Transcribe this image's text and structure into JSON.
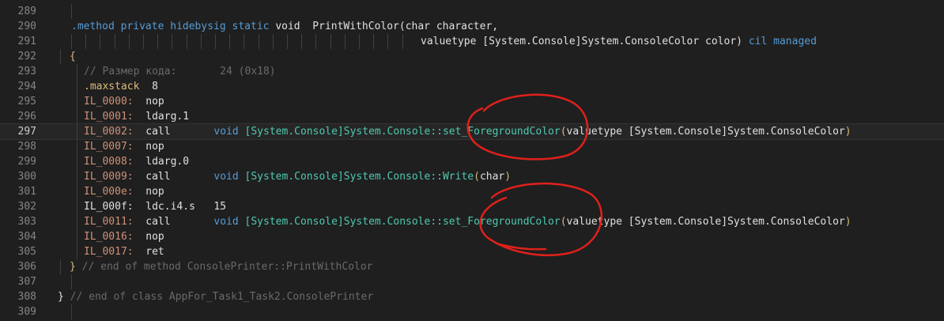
{
  "editor": {
    "lines": [
      {
        "n": "289",
        "segs": []
      },
      {
        "n": "290",
        "segs": [
          {
            "t": ".method",
            "c": "t-kw"
          },
          {
            "t": " "
          },
          {
            "t": "private",
            "c": "t-kw"
          },
          {
            "t": " "
          },
          {
            "t": "hidebysig",
            "c": "t-kw"
          },
          {
            "t": " "
          },
          {
            "t": "static",
            "c": "t-kw"
          },
          {
            "t": " "
          },
          {
            "t": "void",
            "c": "t-white"
          },
          {
            "t": "  "
          },
          {
            "t": "PrintWithColor(char character,",
            "c": "t-white"
          }
        ]
      },
      {
        "n": "291",
        "segs": [
          {
            "t": "valuetype [System.Console]System.ConsoleColor color)",
            "c": "t-white"
          },
          {
            "t": " "
          },
          {
            "t": "cil",
            "c": "t-kw"
          },
          {
            "t": " "
          },
          {
            "t": "managed",
            "c": "t-kw"
          }
        ]
      },
      {
        "n": "292",
        "segs": [
          {
            "t": "{",
            "c": "t-brace"
          }
        ]
      },
      {
        "n": "293",
        "segs": [
          {
            "t": "// Размер кода:       24 (0x18)",
            "c": "t-comment"
          }
        ]
      },
      {
        "n": "294",
        "segs": [
          {
            "t": ".maxstack",
            "c": "t-dir"
          },
          {
            "t": "  "
          },
          {
            "t": "8",
            "c": "t-white"
          }
        ]
      },
      {
        "n": "295",
        "segs": [
          {
            "t": "IL_0000:",
            "c": "t-label"
          },
          {
            "t": "  "
          },
          {
            "t": "nop",
            "c": "t-white"
          }
        ]
      },
      {
        "n": "296",
        "segs": [
          {
            "t": "IL_0001:",
            "c": "t-label"
          },
          {
            "t": "  "
          },
          {
            "t": "ldarg.1",
            "c": "t-white"
          }
        ]
      },
      {
        "n": "297",
        "current": true,
        "segs": [
          {
            "t": "IL_0002:",
            "c": "t-label"
          },
          {
            "t": "  "
          },
          {
            "t": "call",
            "c": "t-white"
          },
          {
            "t": "       "
          },
          {
            "t": "void",
            "c": "t-kw"
          },
          {
            "t": " "
          },
          {
            "t": "[System.Console]System.Console::set_ForegroundColor",
            "c": "t-type"
          },
          {
            "t": "(",
            "c": "t-brace"
          },
          {
            "t": "valuetype [System.Console]System.ConsoleColor",
            "c": "t-white"
          },
          {
            "t": ")",
            "c": "t-brace"
          }
        ]
      },
      {
        "n": "298",
        "segs": [
          {
            "t": "IL_0007:",
            "c": "t-label"
          },
          {
            "t": "  "
          },
          {
            "t": "nop",
            "c": "t-white"
          }
        ]
      },
      {
        "n": "299",
        "segs": [
          {
            "t": "IL_0008:",
            "c": "t-label"
          },
          {
            "t": "  "
          },
          {
            "t": "ldarg.0",
            "c": "t-white"
          }
        ]
      },
      {
        "n": "300",
        "segs": [
          {
            "t": "IL_0009:",
            "c": "t-label"
          },
          {
            "t": "  "
          },
          {
            "t": "call",
            "c": "t-white"
          },
          {
            "t": "       "
          },
          {
            "t": "void",
            "c": "t-kw"
          },
          {
            "t": " "
          },
          {
            "t": "[System.Console]System.Console::Write",
            "c": "t-type"
          },
          {
            "t": "(",
            "c": "t-brace"
          },
          {
            "t": "char",
            "c": "t-white"
          },
          {
            "t": ")",
            "c": "t-brace"
          }
        ]
      },
      {
        "n": "301",
        "segs": [
          {
            "t": "IL_000e:",
            "c": "t-label"
          },
          {
            "t": "  "
          },
          {
            "t": "nop",
            "c": "t-white"
          }
        ]
      },
      {
        "n": "302",
        "segs": [
          {
            "t": "IL_000f:",
            "c": "t-white"
          },
          {
            "t": "  "
          },
          {
            "t": "ldc.i4.s",
            "c": "t-white"
          },
          {
            "t": "   "
          },
          {
            "t": "15",
            "c": "t-white"
          }
        ]
      },
      {
        "n": "303",
        "segs": [
          {
            "t": "IL_0011:",
            "c": "t-label"
          },
          {
            "t": "  "
          },
          {
            "t": "call",
            "c": "t-white"
          },
          {
            "t": "       "
          },
          {
            "t": "void",
            "c": "t-kw"
          },
          {
            "t": " "
          },
          {
            "t": "[System.Console]System.Console::set_ForegroundColor",
            "c": "t-type"
          },
          {
            "t": "(",
            "c": "t-brace"
          },
          {
            "t": "valuetype [System.Console]System.ConsoleColor",
            "c": "t-white"
          },
          {
            "t": ")",
            "c": "t-brace"
          }
        ]
      },
      {
        "n": "304",
        "segs": [
          {
            "t": "IL_0016:",
            "c": "t-label"
          },
          {
            "t": "  "
          },
          {
            "t": "nop",
            "c": "t-white"
          }
        ]
      },
      {
        "n": "305",
        "segs": [
          {
            "t": "IL_0017:",
            "c": "t-label"
          },
          {
            "t": "  "
          },
          {
            "t": "ret",
            "c": "t-white"
          }
        ]
      },
      {
        "n": "306",
        "segs": [
          {
            "t": "}",
            "c": "t-brace"
          },
          {
            "t": " "
          },
          {
            "t": "// end of method ConsolePrinter::PrintWithColor",
            "c": "t-comment"
          }
        ]
      },
      {
        "n": "307",
        "segs": []
      },
      {
        "n": "308",
        "segs": [
          {
            "t": "}",
            "c": "t-white"
          },
          {
            "t": " "
          },
          {
            "t": "// end of class AppFor_Task1_Task2.ConsolePrinter",
            "c": "t-comment"
          }
        ]
      },
      {
        "n": "309",
        "segs": []
      }
    ]
  },
  "colors": {
    "background": "#1f1f1f",
    "current_line": "#262626",
    "keyword": "#569cd6",
    "type": "#4ec9b0",
    "label": "#ce9178",
    "comment": "#6a6a6a",
    "annotation": "#e0201b"
  }
}
